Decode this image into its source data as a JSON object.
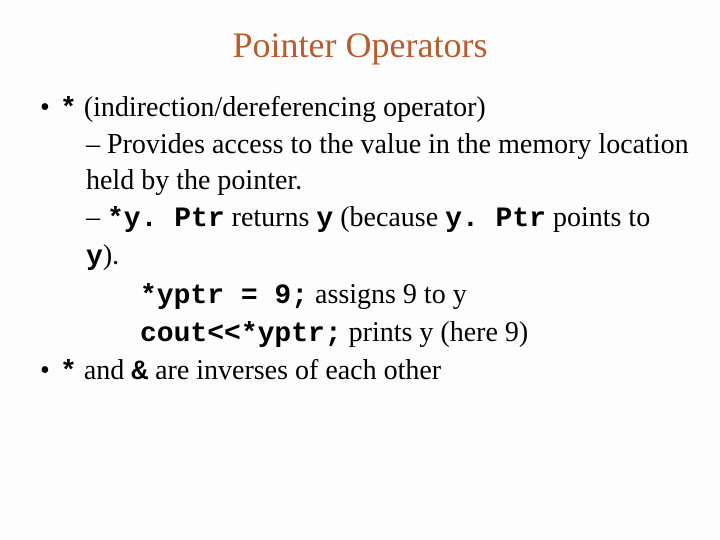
{
  "title": "Pointer Operators",
  "b1_symbol": "*",
  "b1_text": " (indirection/dereferencing operator)",
  "sub1_dash": "– ",
  "sub1_text": "Provides access to the value in the memory location held by the pointer.",
  "sub2_dash": "– ",
  "sub2_code": "*y. Ptr",
  "sub2_mid": " returns ",
  "sub2_y": "y",
  "sub2_because": " (because ",
  "sub2_yptr2": "y. Ptr",
  "sub2_tail": " points to ",
  "sub2_y2": "y",
  "sub2_end": ").",
  "ex1_code": "*yptr = 9;",
  "ex1_text": "  assigns 9 to y",
  "ex2_code": "cout<<*yptr;",
  "ex2_text": "  prints y (here 9)",
  "b2_symbol": "*",
  "b2_mid": "  and ",
  "b2_amp": "&",
  "b2_text": " are inverses of each other"
}
